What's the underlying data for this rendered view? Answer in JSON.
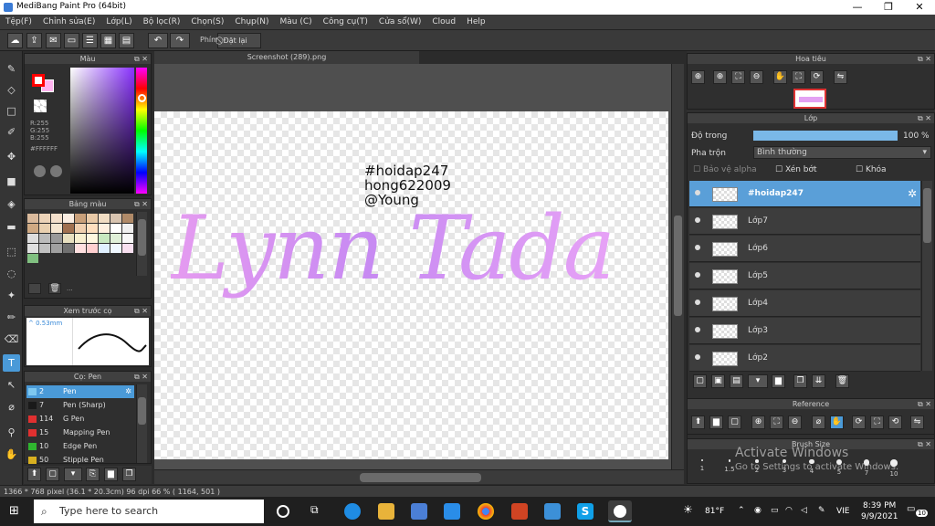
{
  "window": {
    "title": "MediBang Paint Pro (64bit)",
    "min": "—",
    "max": "❐",
    "close": "✕"
  },
  "menu": [
    "Tệp(F)",
    "Chỉnh sửa(E)",
    "Lớp(L)",
    "Bộ lọc(R)",
    "Chọn(S)",
    "Chụp(N)",
    "Màu (C)",
    "Công cụ(T)",
    "Cửa sổ(W)",
    "Cloud",
    "Help"
  ],
  "toolbar": {
    "shortcut_label": "Phím",
    "reset_label": "Đặt lại"
  },
  "color_panel": {
    "title": "Màu",
    "r": "R:255",
    "g": "G:255",
    "b": "B:255",
    "hex": "#FFFFFF",
    "primary": "#ff0000",
    "secondary": "#ffb3f0"
  },
  "palette_panel": {
    "title": "Bảng màu",
    "extra": "..."
  },
  "preview_panel": {
    "title": "Xem trước cọ",
    "size": "0.53mm"
  },
  "brush_panel": {
    "title": "Cọ: Pen",
    "items": [
      {
        "num": "2",
        "label": "Pen",
        "color": "#7ec8f0"
      },
      {
        "num": "7",
        "label": "Pen (Sharp)",
        "color": "#1a1a1a"
      },
      {
        "num": "114",
        "label": "G Pen",
        "color": "#e03030"
      },
      {
        "num": "15",
        "label": "Mapping Pen",
        "color": "#e03030"
      },
      {
        "num": "10",
        "label": "Edge Pen",
        "color": "#2fb52f"
      },
      {
        "num": "50",
        "label": "Stipple Pen",
        "color": "#d8b020"
      }
    ]
  },
  "document": {
    "tab": "Screenshot (289).png",
    "line1": "#hoidap247",
    "line2": "hong622009",
    "line3": "@Young",
    "lettering": "Lynn Tada"
  },
  "navigator": {
    "title": "Hoa tiêu"
  },
  "layer_panel": {
    "title": "Lớp",
    "opacity_label": "Độ trong",
    "opacity_value": "100 %",
    "opacity": 1.0,
    "blend_label": "Pha trộn",
    "blend_value": "Bình thường",
    "protect_alpha": "Bảo vệ alpha",
    "clip": "Xén bớt",
    "lock": "Khóa",
    "layers": [
      "#hoidap247",
      "Lớp7",
      "Lớp6",
      "Lớp5",
      "Lớp4",
      "Lớp3",
      "Lớp2"
    ]
  },
  "reference_panel": {
    "title": "Reference"
  },
  "brushsize_panel": {
    "title": "Brush Size",
    "sizes": [
      "1",
      "1.5",
      "2",
      "3",
      "4",
      "5",
      "7",
      "10"
    ]
  },
  "status": {
    "text": "1366 * 768 pixel  (36.1 * 20.3cm)  96 dpi  66 %  ( 1164, 501 )"
  },
  "watermark": {
    "line1": "Activate Windows",
    "line2": "Go to Settings to activate Windows."
  },
  "taskbar": {
    "search_placeholder": "Type here to search",
    "weather": "81°F",
    "lang": "VIE",
    "time": "8:39 PM",
    "date": "9/9/2021",
    "badge": "10"
  }
}
